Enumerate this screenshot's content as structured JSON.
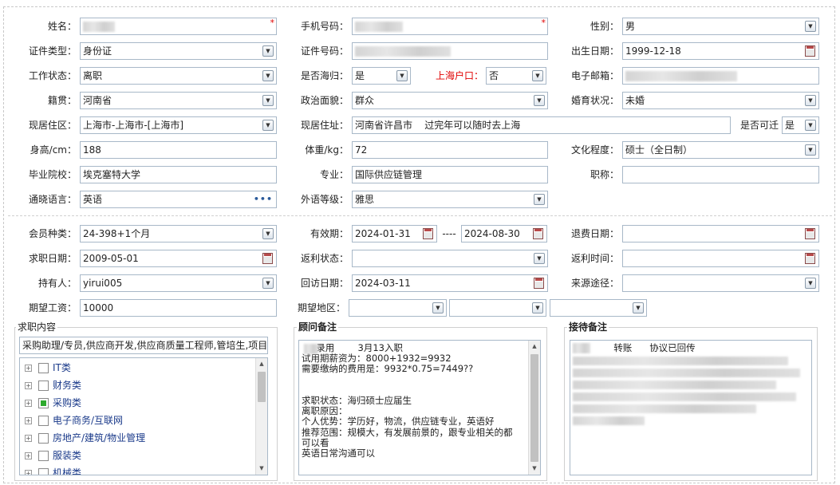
{
  "form": {
    "name_label": "姓名：",
    "phone_label": "手机号码：",
    "gender_label": "性别：",
    "gender_value": "男",
    "id_type_label": "证件类型：",
    "id_type_value": "身份证",
    "id_number_label": "证件号码：",
    "birthdate_label": "出生日期：",
    "birthdate_value": "1999-12-18",
    "work_status_label": "工作状态：",
    "work_status_value": "离职",
    "returnee_label": "是否海归：",
    "returnee_value": "是",
    "shanghai_hukou_label": "上海户口：",
    "shanghai_hukou_value": "否",
    "email_label": "电子邮箱：",
    "native_label": "籍贯：",
    "native_value": "河南省",
    "political_label": "政治面貌：",
    "political_value": "群众",
    "marital_label": "婚育状况：",
    "marital_value": "未婚",
    "current_area_label": "现居住区：",
    "current_area_value": "上海市-上海市-[上海市]",
    "current_address_label": "现居住址：",
    "current_address_value": "河南省许昌市    过完年可以随时去上海",
    "relocate_label": "是否可迁",
    "relocate_value": "是",
    "height_label": "身高/cm：",
    "height_value": "188",
    "weight_label": "体重/kg：",
    "weight_value": "72",
    "education_label": "文化程度：",
    "education_value": "硕士（全日制）",
    "school_label": "毕业院校：",
    "school_value": "埃克塞特大学",
    "major_label": "专业：",
    "major_value": "国际供应链管理",
    "title_label": "职称：",
    "language_label": "通晓语言：",
    "language_value": "英语",
    "language_more": "•••",
    "foreign_level_label": "外语等级：",
    "foreign_level_value": "雅思",
    "required_mark": "*"
  },
  "membership": {
    "member_type_label": "会员种类：",
    "member_type_value": "24-398+1个月",
    "validity_label": "有效期：",
    "validity_start": "2024-01-31",
    "validity_sep": "----",
    "validity_end": "2024-08-30",
    "refund_date_label": "退费日期：",
    "job_date_label": "求职日期：",
    "job_date_value": "2009-05-01",
    "rebate_status_label": "返利状态：",
    "rebate_time_label": "返利时间：",
    "holder_label": "持有人：",
    "holder_value": "yirui005",
    "revisit_label": "回访日期：",
    "revisit_value": "2024-03-11",
    "source_label": "来源途径：",
    "salary_label": "期望工资：",
    "salary_value": "10000",
    "region_label": "期望地区："
  },
  "job_content": {
    "legend": "求职内容",
    "summary": "采购助理/专员,供应商开发,供应商质量工程师,管培生,项目",
    "items": [
      {
        "label": "IT类",
        "checked": false
      },
      {
        "label": "财务类",
        "checked": false
      },
      {
        "label": "采购类",
        "checked": true
      },
      {
        "label": "电子商务/互联网",
        "checked": false
      },
      {
        "label": "房地产/建筑/物业管理",
        "checked": false
      },
      {
        "label": "服装类",
        "checked": false
      },
      {
        "label": "机械类",
        "checked": false
      }
    ]
  },
  "advisor_notes": {
    "legend": "顾问备注",
    "lines": [
      "     录用        3月13入职",
      "试用期薪资为：8000+1932=9932",
      "需要缴纳的费用是：9932*0.75=7449??",
      "",
      "",
      "求职状态：海归硕士应届生",
      "离职原因：",
      "个人优势：学历好，物流，供应链专业，英语好",
      "推荐范围：规模大，有发展前景的，跟专业相关的都",
      "可以看",
      "英语日常沟通可以"
    ]
  },
  "reception_notes": {
    "legend": "接待备注",
    "line1_a": "转账",
    "line1_b": "协议已回传"
  },
  "colors": {
    "border": "#a8b8c8",
    "required": "#e00000",
    "tree_text": "#1a3a8a",
    "checkbox_on": "#2eaa2e"
  }
}
